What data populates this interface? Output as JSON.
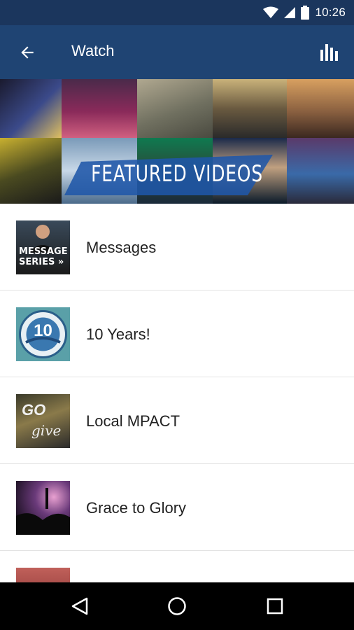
{
  "status_bar": {
    "time": "10:26"
  },
  "app_bar": {
    "title": "Watch"
  },
  "banner": {
    "title": "FEATURED VIDEOS"
  },
  "list_items": [
    {
      "label": "Messages",
      "thumb_text": [
        "MESSAGE",
        "SERIES »"
      ]
    },
    {
      "label": "10 Years!",
      "thumb_text": [
        "10"
      ]
    },
    {
      "label": "Local MPACT",
      "thumb_text": [
        "GO",
        "give"
      ]
    },
    {
      "label": "Grace to Glory",
      "thumb_text": []
    }
  ],
  "colors": {
    "status_bar": "#1b365d",
    "app_bar": "#1f4473",
    "accent": "#2a5fa8"
  }
}
